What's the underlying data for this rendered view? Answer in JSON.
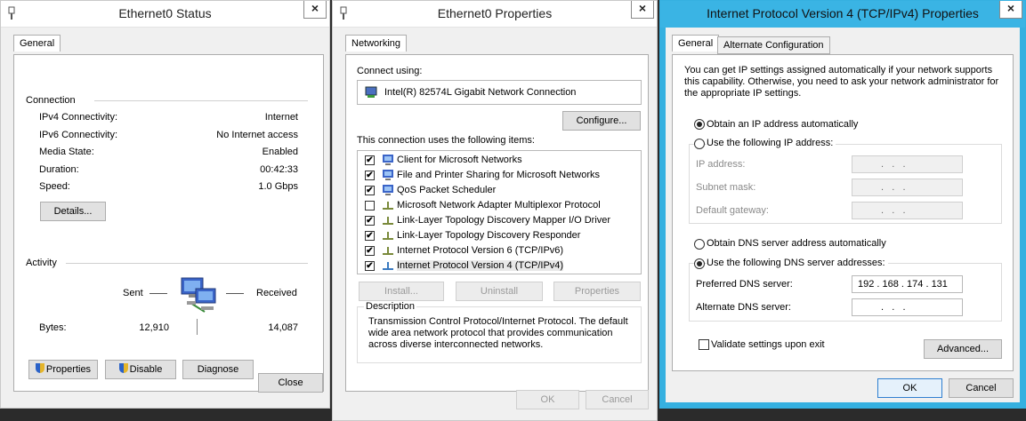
{
  "status": {
    "title": "Ethernet0 Status",
    "tab": "General",
    "connection_header": "Connection",
    "rows": [
      {
        "label": "IPv4 Connectivity:",
        "value": "Internet"
      },
      {
        "label": "IPv6 Connectivity:",
        "value": "No Internet access"
      },
      {
        "label": "Media State:",
        "value": "Enabled"
      },
      {
        "label": "Duration:",
        "value": "00:42:33"
      },
      {
        "label": "Speed:",
        "value": "1.0 Gbps"
      }
    ],
    "details_btn": "Details...",
    "activity_header": "Activity",
    "sent": "Sent",
    "received": "Received",
    "bytes_label": "Bytes:",
    "bytes_sent": "12,910",
    "bytes_received": "14,087",
    "properties_btn": "Properties",
    "disable_btn": "Disable",
    "diagnose_btn": "Diagnose",
    "close_btn": "Close"
  },
  "props": {
    "title": "Ethernet0 Properties",
    "tab": "Networking",
    "connect_using": "Connect using:",
    "adapter": "Intel(R) 82574L Gigabit Network Connection",
    "configure_btn": "Configure...",
    "items_label": "This connection uses the following items:",
    "items": [
      {
        "label": "Client for Microsoft Networks",
        "checked": true
      },
      {
        "label": "File and Printer Sharing for Microsoft Networks",
        "checked": true
      },
      {
        "label": "QoS Packet Scheduler",
        "checked": true
      },
      {
        "label": "Microsoft Network Adapter Multiplexor Protocol",
        "checked": false
      },
      {
        "label": "Link-Layer Topology Discovery Mapper I/O Driver",
        "checked": true
      },
      {
        "label": "Link-Layer Topology Discovery Responder",
        "checked": true
      },
      {
        "label": "Internet Protocol Version 6 (TCP/IPv6)",
        "checked": true
      },
      {
        "label": "Internet Protocol Version 4 (TCP/IPv4)",
        "checked": true
      }
    ],
    "install_btn": "Install...",
    "uninstall_btn": "Uninstall",
    "properties_btn": "Properties",
    "description_header": "Description",
    "description": "Transmission Control Protocol/Internet Protocol. The default wide area network protocol that provides communication across diverse interconnected networks.",
    "ok_btn": "OK",
    "cancel_btn": "Cancel"
  },
  "ipv4": {
    "title": "Internet Protocol Version 4 (TCP/IPv4) Properties",
    "tab_general": "General",
    "tab_alternate": "Alternate Configuration",
    "intro": "You can get IP settings assigned automatically if your network supports this capability. Otherwise, you need to ask your network administrator for the appropriate IP settings.",
    "obtain_ip_auto": "Obtain an IP address automatically",
    "use_following_ip": "Use the following IP address:",
    "ip_address_label": "IP address:",
    "subnet_label": "Subnet mask:",
    "gateway_label": "Default gateway:",
    "empty_ip": ".   .   .",
    "obtain_dns_auto": "Obtain DNS server address automatically",
    "use_following_dns": "Use the following DNS server addresses:",
    "preferred_dns_label": "Preferred DNS server:",
    "preferred_dns_value": "192 . 168 . 174 . 131",
    "alternate_dns_label": "Alternate DNS server:",
    "validate_label": "Validate settings upon exit",
    "advanced_btn": "Advanced...",
    "ok_btn": "OK",
    "cancel_btn": "Cancel"
  },
  "icons": {
    "close": "×"
  }
}
